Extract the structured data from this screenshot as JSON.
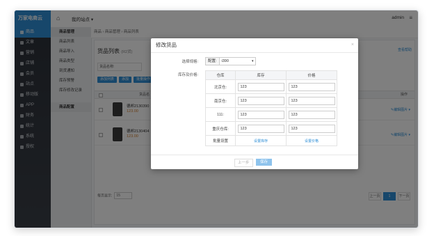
{
  "app": {
    "logo": "万家电商云",
    "site": "我的站点",
    "site_caret": "▾",
    "user": "admin",
    "home_icon": "home-icon",
    "menu_icon": "menu-icon"
  },
  "sidebar": {
    "items": [
      {
        "label": "商品",
        "active": true
      },
      {
        "label": "文章"
      },
      {
        "label": "营销"
      },
      {
        "label": "店铺"
      },
      {
        "label": "会员"
      },
      {
        "label": "站点"
      },
      {
        "label": "移动版"
      },
      {
        "label": "APP"
      },
      {
        "label": "财务"
      },
      {
        "label": "统计"
      },
      {
        "label": "系统"
      },
      {
        "label": "授权"
      }
    ]
  },
  "submenu": {
    "items": [
      {
        "label": "商品管理",
        "group": true
      },
      {
        "label": "商品列表"
      },
      {
        "label": "商品导入"
      },
      {
        "label": "商品类型"
      },
      {
        "label": "到货通知"
      },
      {
        "label": "库存预警"
      },
      {
        "label": "库存修改记录"
      },
      {
        "label": "商品配置",
        "group": true
      }
    ]
  },
  "breadcrumb": {
    "text": "商品 › 商品管理 › 商品列表"
  },
  "page": {
    "title": "货品列表",
    "count": "(R2货)",
    "help": "查看帮助"
  },
  "search": {
    "label": "货品名称:"
  },
  "buttons": {
    "list": "添加列表",
    "add": "添加",
    "batch": "批量操作"
  },
  "table": {
    "col_name": "货品名",
    "col_op": "操作"
  },
  "rows": [
    {
      "name": "德邦2130390",
      "price": "123.00",
      "action": "✎编辑图片 ▾"
    },
    {
      "name": "德邦2130404",
      "price": "123.00",
      "action": "✎编辑图片 ▾"
    }
  ],
  "footer": {
    "per_page_label": "每页显示:",
    "per_page": "15"
  },
  "pager": {
    "prev": "上一页",
    "current": "1",
    "next": "下一页"
  },
  "modal": {
    "title": "修改货品",
    "close": "×",
    "spec_label": "选择规格:",
    "spec_button": "配置:",
    "spec_value": "i390",
    "spec_caret": "▾",
    "stock_label": "库存及价格:",
    "col_warehouse": "仓库",
    "col_stock": "库存",
    "col_price": "价格",
    "rows": [
      {
        "wh": "北京仓:",
        "stock": "123",
        "price": "123"
      },
      {
        "wh": "南京仓:",
        "stock": "123",
        "price": "123"
      },
      {
        "wh": "111:",
        "stock": "123",
        "price": "123"
      },
      {
        "wh": "重庆仓库:",
        "stock": "123",
        "price": "123"
      }
    ],
    "batch_label": "批量设置",
    "set_stock": "设置库存",
    "set_price": "设置价格",
    "prev": "上一步",
    "save": "保存"
  }
}
